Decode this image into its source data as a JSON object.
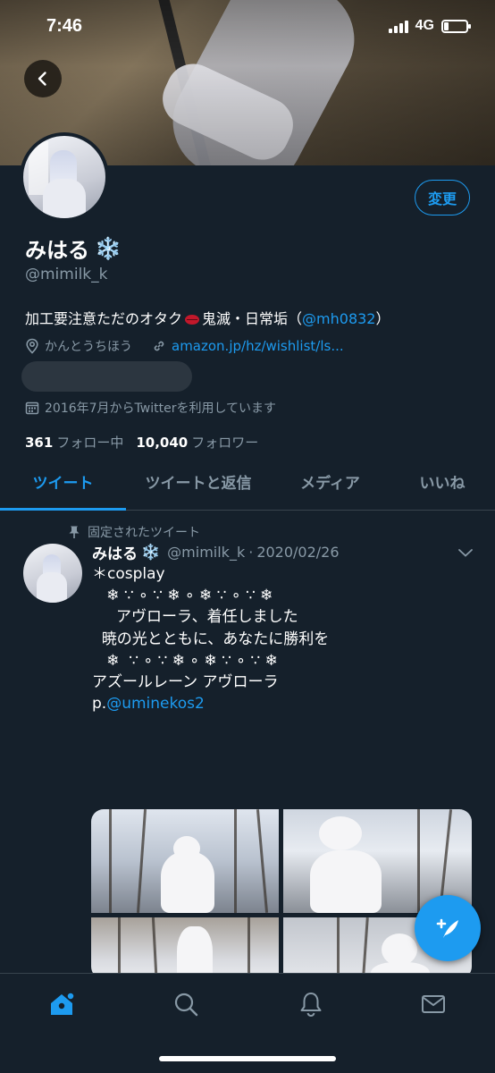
{
  "status_bar": {
    "time": "7:46",
    "network": "4G"
  },
  "profile": {
    "edit_button": "変更",
    "display_name": "みはる",
    "name_emoji": "❄️",
    "handle": "@mimilk_k",
    "bio_text": "加工要注意ただのオタク",
    "bio_text_2": "鬼滅・日常垢（",
    "bio_mention": "@mh0832",
    "bio_close": "）",
    "location": "かんとうちほう",
    "link": "amazon.jp/hz/wishlist/ls...",
    "joined": "2016年7月からTwitterを利用しています",
    "following_count": "361",
    "following_label": "フォロー中",
    "followers_count": "10,040",
    "followers_label": "フォロワー"
  },
  "tabs": [
    {
      "label": "ツイート",
      "active": true
    },
    {
      "label": "ツイートと返信",
      "active": false
    },
    {
      "label": "メディア",
      "active": false
    },
    {
      "label": "いいね",
      "active": false
    }
  ],
  "tweet": {
    "pinned_label": "固定されたツイート",
    "author_name": "みはる",
    "author_emoji": "❄️",
    "author_handle": "@mimilk_k",
    "separator": "·",
    "date": "2020/02/26",
    "lines": [
      "＊cosplay",
      "",
      "   ❄ ∵ ∘ ∵ ❄ ∘ ❄ ∵ ∘ ∵ ❄",
      "",
      "     アヴローラ、着任しました",
      "  暁の光とともに、あなたに勝利を",
      "",
      "   ❄  ∵ ∘ ∵ ❄ ∘ ❄ ∵ ∘ ∵ ❄",
      "",
      "アズールレーン アヴローラ"
    ],
    "credit_prefix": "p.",
    "credit_mention": "@uminekos2"
  },
  "bottom_nav": [
    "home-icon",
    "search-icon",
    "notifications-icon",
    "messages-icon"
  ],
  "colors": {
    "background": "#15202b",
    "accent": "#1d9bf0",
    "muted": "#8899a6",
    "divider": "#38444d"
  }
}
